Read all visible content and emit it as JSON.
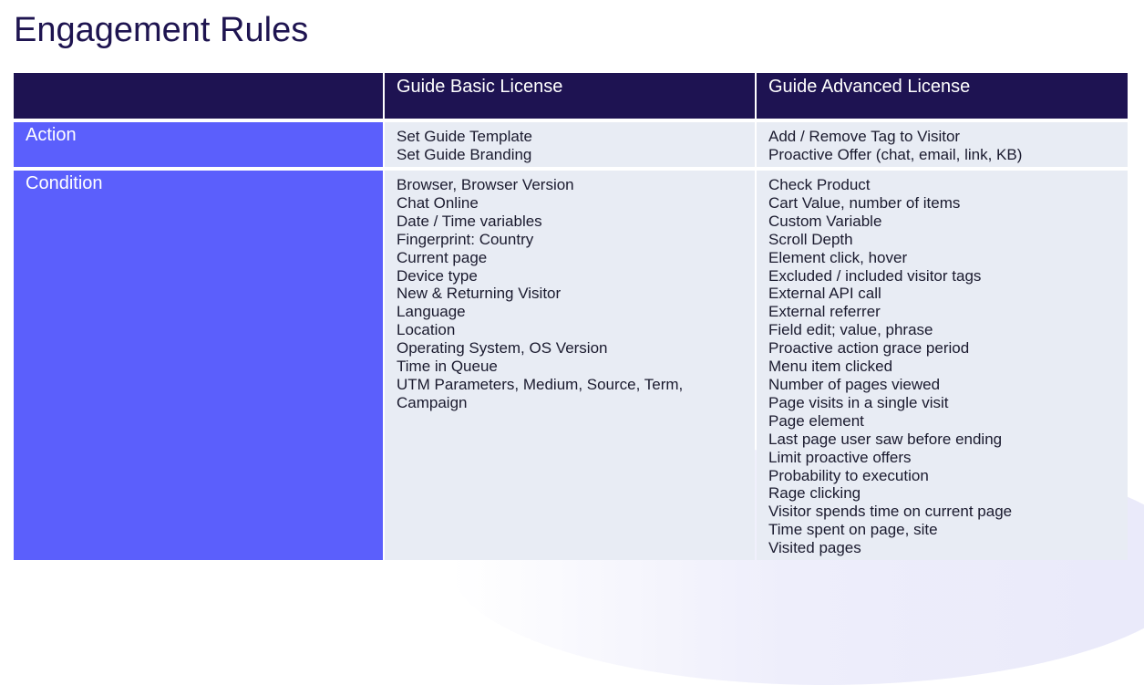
{
  "page": {
    "title": "Engagement Rules"
  },
  "table": {
    "headers": [
      "",
      "Guide Basic License",
      "Guide Advanced License"
    ],
    "rows": [
      {
        "label": "Action",
        "basic": [
          "Set Guide Template",
          "Set Guide Branding"
        ],
        "advanced": [
          "Add / Remove Tag to Visitor",
          "Proactive Offer (chat, email, link, KB)"
        ]
      },
      {
        "label": "Condition",
        "basic": [
          "Browser, Browser Version",
          "Chat Online",
          "Date / Time variables",
          "Fingerprint: Country",
          "Current page",
          "Device type",
          "New & Returning Visitor",
          "Language",
          "Location",
          "Operating System, OS Version",
          "Time in Queue",
          "UTM Parameters, Medium, Source, Term,",
          "Campaign"
        ],
        "advanced": [
          "Check Product",
          "Cart Value, number of items",
          "Custom Variable",
          "Scroll Depth",
          "Element click, hover",
          "Excluded / included visitor tags",
          "External API call",
          "External referrer",
          "Field edit; value, phrase",
          "Proactive action grace period",
          "Menu item clicked",
          "Number of pages viewed",
          "Page visits in a single visit",
          "Page element",
          "Last page user saw before ending",
          "Limit proactive offers",
          "Probability to execution",
          "Rage clicking",
          "Visitor spends time on current page",
          "Time spent on page, site",
          "Visited pages"
        ]
      }
    ]
  },
  "colors": {
    "header_bg": "#1e1352",
    "row_header_bg": "#5b5ffc",
    "cell_bg": "#e8ecf4",
    "title_color": "#1e1450"
  }
}
